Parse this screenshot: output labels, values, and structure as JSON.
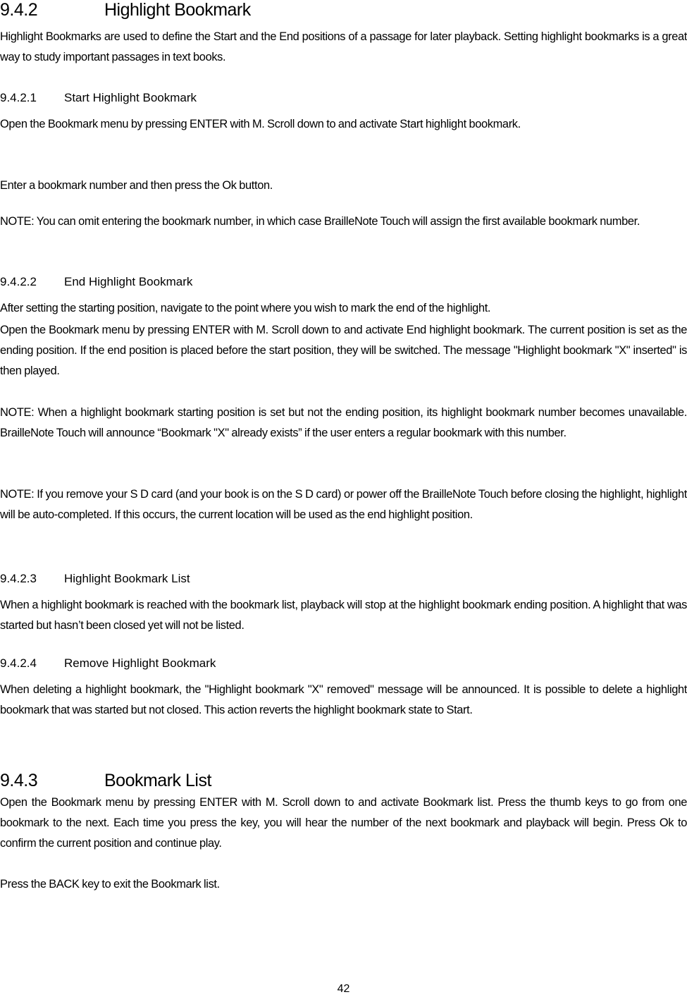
{
  "document": {
    "sections": [
      {
        "id": "9.4.2",
        "number": "9.4.2",
        "title": "Highlight Bookmark",
        "paragraphs": [
          "Highlight Bookmarks are used to define the Start and the End positions of a passage for later playback. Setting highlight bookmarks is a great way to study important passages in text books."
        ]
      },
      {
        "id": "9.4.2.1",
        "number": "9.4.2.1",
        "title": "Start Highlight Bookmark",
        "paragraphs": [
          "Open the Bookmark menu by pressing ENTER with M. Scroll down to and activate Start highlight bookmark.",
          "Enter a bookmark number and then press the Ok button.",
          "NOTE: You can omit entering the bookmark number, in which case BrailleNote Touch will assign the first available bookmark number."
        ]
      },
      {
        "id": "9.4.2.2",
        "number": "9.4.2.2",
        "title": "End Highlight Bookmark",
        "paragraphs": [
          "After setting the starting position, navigate to the point where you wish to mark the end of the highlight.",
          "Open the Bookmark menu by pressing ENTER with M. Scroll down to and activate End highlight bookmark. The current position is set as the ending position. If the end position is placed before the start position, they will be switched. The message \"Highlight bookmark \"X\" inserted\" is then played.",
          "NOTE: When a highlight bookmark starting position is set but not the ending position, its highlight bookmark number becomes unavailable. BrailleNote Touch will announce “Bookmark \"X\" already exists” if the user enters a regular bookmark with this number.",
          "NOTE: If you remove your S D card (and your book is on the S D card) or power off the BrailleNote Touch before closing the highlight, highlight will be auto-completed. If this occurs, the current location will be used as the end highlight position."
        ]
      },
      {
        "id": "9.4.2.3",
        "number": "9.4.2.3",
        "title": "Highlight Bookmark List",
        "paragraphs": [
          "When a highlight bookmark is reached with the bookmark list, playback will stop at the highlight bookmark ending position. A highlight that was started but hasn’t been closed yet will not be listed."
        ]
      },
      {
        "id": "9.4.2.4",
        "number": "9.4.2.4",
        "title": "Remove Highlight Bookmark",
        "paragraphs": [
          "When deleting a highlight bookmark, the \"Highlight bookmark \"X\" removed\" message will be announced. It is possible to delete a highlight bookmark that was started but not closed. This action reverts the highlight bookmark state to Start."
        ]
      },
      {
        "id": "9.4.3",
        "number": "9.4.3",
        "title": "Bookmark List",
        "paragraphs": [
          "Open the Bookmark menu by pressing ENTER with M. Scroll down to and activate Bookmark list. Press the thumb keys to go from one bookmark to the next. Each time you press the key, you will hear the number of the next bookmark and playback will begin. Press Ok to confirm the current position and continue play.",
          "Press the BACK key to exit the Bookmark list."
        ]
      }
    ],
    "page_number": "42"
  }
}
